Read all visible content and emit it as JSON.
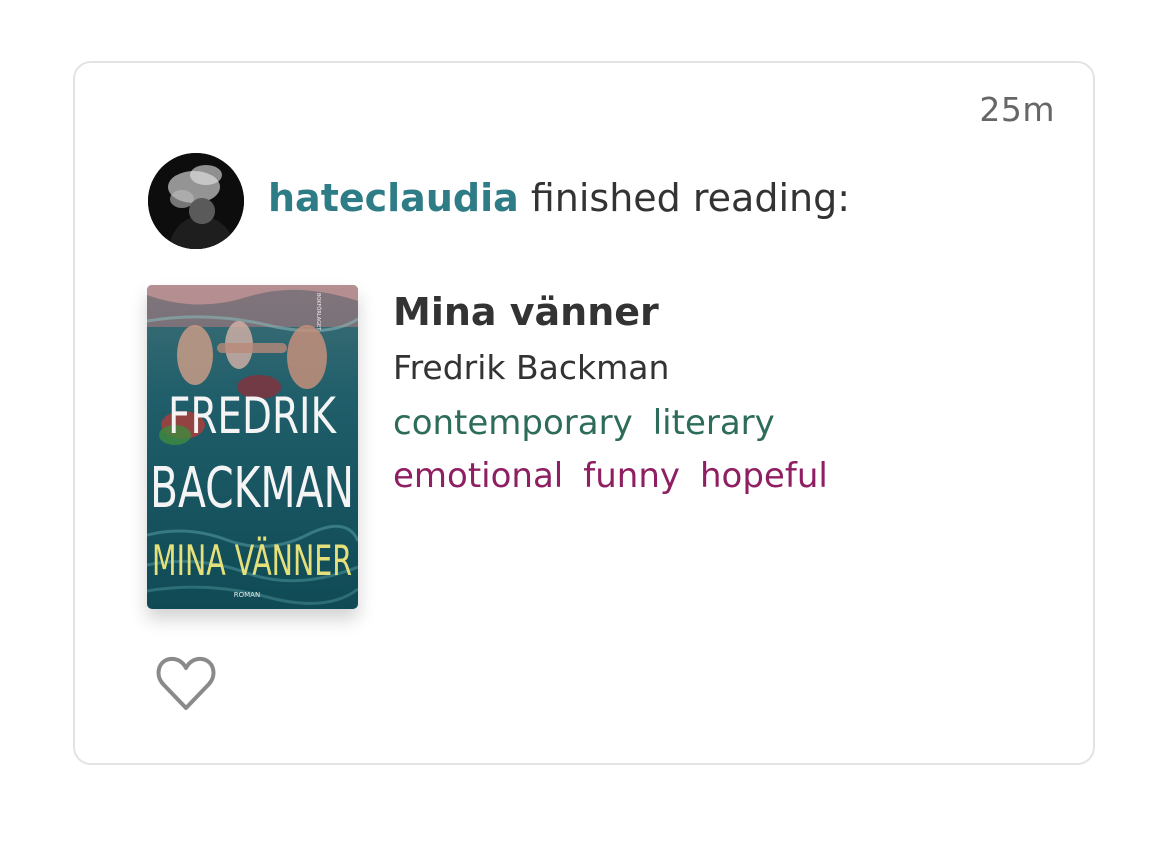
{
  "post": {
    "timestamp": "25m",
    "user": {
      "username": "hateclaudia",
      "avatar": "user-avatar"
    },
    "action": "finished reading:",
    "book": {
      "title": "Mina vänner",
      "author": "Fredrik Backman",
      "genres": [
        "contemporary",
        "literary"
      ],
      "moods": [
        "emotional",
        "funny",
        "hopeful"
      ],
      "cover": {
        "author_line1": "FREDRIK",
        "author_line2": "BACKMAN",
        "title": "MINA VÄNNER",
        "subtitle": "ROMAN",
        "publisher": "BOKFÖRLAGET"
      }
    },
    "like_icon": "heart-outline-icon"
  },
  "colors": {
    "username": "#2e7c85",
    "genre": "#2d6b5a",
    "mood": "#8e1f63",
    "text": "#333333",
    "timestamp": "#666666",
    "border": "#e3e3e3"
  }
}
